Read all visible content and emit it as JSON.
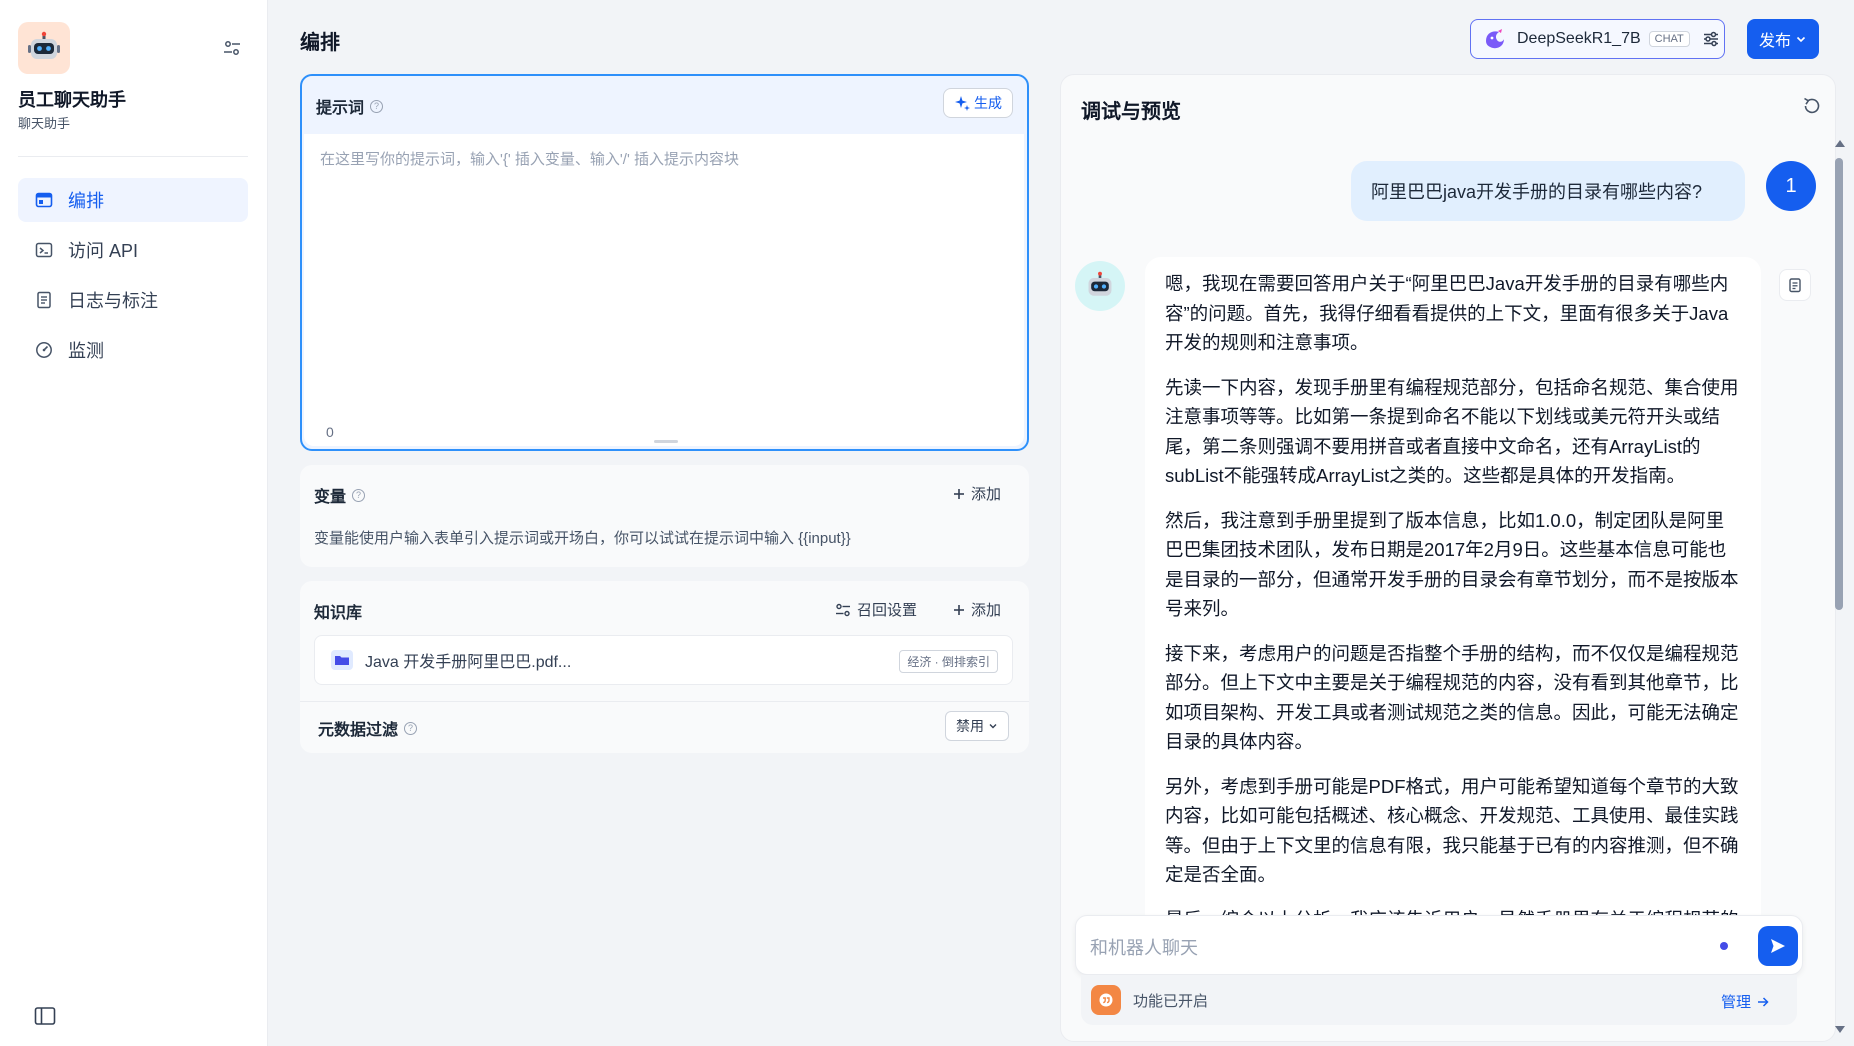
{
  "app": {
    "name": "员工聊天助手",
    "type": "聊天助手",
    "avatar_icon": "robot-icon"
  },
  "nav": {
    "items": [
      {
        "label": "编排",
        "icon": "layout-icon",
        "active": true
      },
      {
        "label": "访问 API",
        "icon": "terminal-icon",
        "active": false
      },
      {
        "label": "日志与标注",
        "icon": "document-icon",
        "active": false
      },
      {
        "label": "监测",
        "icon": "gauge-icon",
        "active": false
      }
    ]
  },
  "header": {
    "title": "编排",
    "model_name": "DeepSeekR1_7B",
    "model_badge": "CHAT",
    "publish_label": "发布"
  },
  "prompt": {
    "label": "提示词",
    "generate_label": "生成",
    "placeholder": "在这里写你的提示词，输入'{' 插入变量、输入'/' 插入提示内容块",
    "char_count": "0"
  },
  "variables": {
    "label": "变量",
    "add_label": "添加",
    "description": "变量能使用户输入表单引入提示词或开场白，你可以试试在提示词中输入 {{input}}"
  },
  "knowledge": {
    "label": "知识库",
    "recall_label": "召回设置",
    "add_label": "添加",
    "items": [
      {
        "name": "Java 开发手册阿里巴巴.pdf...",
        "tag": "经济 · 倒排索引"
      }
    ]
  },
  "metadata_filter": {
    "label": "元数据过滤",
    "value": "禁用"
  },
  "preview": {
    "title": "调试与预览",
    "user_avatar": "1",
    "user_message": "阿里巴巴java开发手册的目录有哪些内容?",
    "bot_paragraphs": [
      "嗯，我现在需要回答用户关于“阿里巴巴Java开发手册的目录有哪些内容”的问题。首先，我得仔细看看提供的上下文，里面有很多关于Java开发的规则和注意事项。",
      "先读一下内容，发现手册里有编程规范部分，包括命名规范、集合使用注意事项等等。比如第一条提到命名不能以下划线或美元符开头或结尾，第二条则强调不要用拼音或者直接中文命名，还有ArrayList的subList不能强转成ArrayList之类的。这些都是具体的开发指南。",
      "然后，我注意到手册里提到了版本信息，比如1.0.0，制定团队是阿里巴巴集团技术团队，发布日期是2017年2月9日。这些基本信息可能也是目录的一部分，但通常开发手册的目录会有章节划分，而不是按版本号来列。",
      "接下来，考虑用户的问题是否指整个手册的结构，而不仅仅是编程规范部分。但上下文中主要是关于编程规范的内容，没有看到其他章节，比如项目架构、开发工具或者测试规范之类的信息。因此，可能无法确定目录的具体内容。",
      "另外，考虑到手册可能是PDF格式，用户可能希望知道每个章节的大致内容，比如可能包括概述、核心概念、开发规范、工具使用、最佳实践等。但由于上下文里的信息有限，我只能基于已有的内容推测，但不确定是否全面。",
      "最后，综合以上分析，我应该告诉用户，虽然手册里有关于编程规范的内容，但完整的目录可能需要查看原始文档才能确认。"
    ],
    "input_placeholder": "和机器人聊天",
    "features_text": "功能已开启",
    "manage_label": "管理"
  },
  "colors": {
    "primary": "#155eef",
    "prompt_border": "#2e90fa",
    "features_icon": "#f38744"
  }
}
